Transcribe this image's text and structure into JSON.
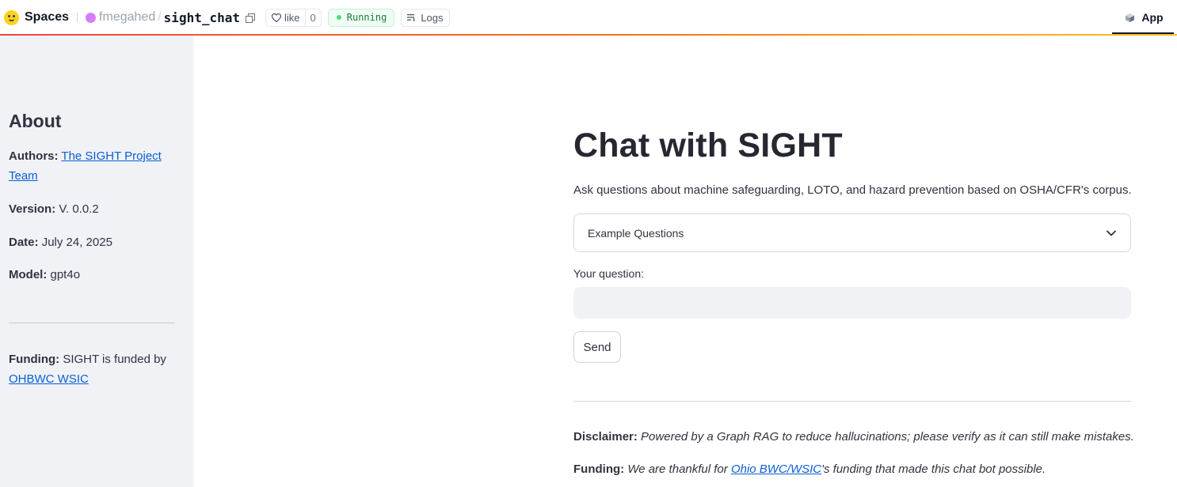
{
  "topbar": {
    "brand": "Spaces",
    "owner": "fmegahed",
    "separator": "/",
    "space_name": "sight_chat",
    "like_label": "like",
    "like_count": "0",
    "status": "Running",
    "logs_label": "Logs",
    "app_tab": "App",
    "accent_colors": [
      "#ef4444",
      "#f97316",
      "#fbbf24"
    ]
  },
  "sidebar": {
    "title": "About",
    "authors_label": "Authors:",
    "authors_link": "The SIGHT Project Team",
    "version_label": "Version:",
    "version_value": "V. 0.0.2",
    "date_label": "Date:",
    "date_value": "July 24, 2025",
    "model_label": "Model:",
    "model_value": "gpt4o",
    "funding_label": "Funding:",
    "funding_text": "SIGHT is funded by",
    "funding_link": "OHBWC WSIC"
  },
  "main": {
    "title": "Chat with SIGHT",
    "subtitle": "Ask questions about machine safeguarding, LOTO, and hazard prevention based on OSHA/CFR's corpus.",
    "expander_label": "Example Questions",
    "question_label": "Your question:",
    "question_value": "",
    "send_label": "Send",
    "disclaimer_label": "Disclaimer:",
    "disclaimer_text": "Powered by a Graph RAG to reduce hallucinations; please verify as it can still make mistakes.",
    "funding_label": "Funding:",
    "funding_pre": "We are thankful for",
    "funding_link": "Ohio BWC/WSIC",
    "funding_post": "'s funding that made this chat bot possible."
  }
}
